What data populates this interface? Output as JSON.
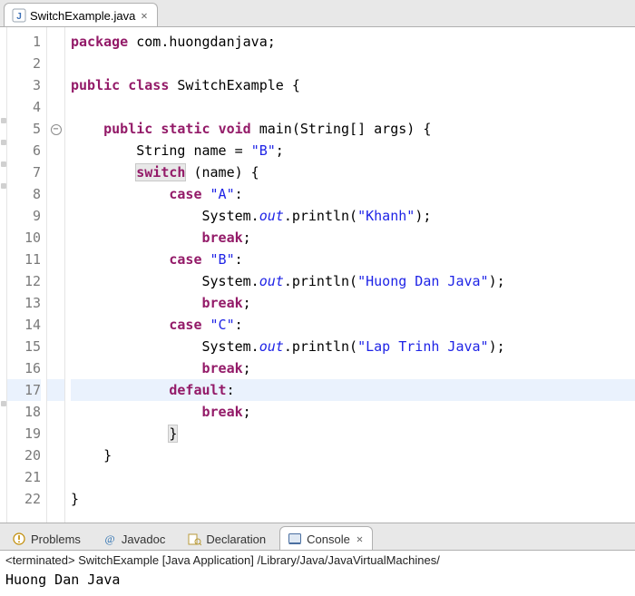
{
  "editor": {
    "tab": {
      "filename": "SwitchExample.java",
      "close_glyph": "✕"
    },
    "line_count": 22,
    "fold_line": 5,
    "current_line": 17,
    "boxed_ranges": [
      {
        "line": 7,
        "token": "switch"
      },
      {
        "line": 19,
        "token": "}"
      }
    ],
    "tokens": {
      "l1": [
        {
          "t": "kw",
          "v": "package"
        },
        {
          "t": "pun",
          "v": " "
        },
        {
          "t": "id",
          "v": "com.huongdanjava;"
        }
      ],
      "l2": [
        {
          "t": "pun",
          "v": ""
        }
      ],
      "l3": [
        {
          "t": "kw",
          "v": "public"
        },
        {
          "t": "pun",
          "v": " "
        },
        {
          "t": "kw",
          "v": "class"
        },
        {
          "t": "pun",
          "v": " "
        },
        {
          "t": "id",
          "v": "SwitchExample {"
        }
      ],
      "l4": [
        {
          "t": "pun",
          "v": ""
        }
      ],
      "l5": [
        {
          "t": "pun",
          "v": "    "
        },
        {
          "t": "kw",
          "v": "public"
        },
        {
          "t": "pun",
          "v": " "
        },
        {
          "t": "kw",
          "v": "static"
        },
        {
          "t": "pun",
          "v": " "
        },
        {
          "t": "kw",
          "v": "void"
        },
        {
          "t": "pun",
          "v": " "
        },
        {
          "t": "id",
          "v": "main(String[] args) {"
        }
      ],
      "l6": [
        {
          "t": "pun",
          "v": "        String name = "
        },
        {
          "t": "str",
          "v": "\"B\""
        },
        {
          "t": "pun",
          "v": ";"
        }
      ],
      "l7": [
        {
          "t": "pun",
          "v": "        "
        },
        {
          "t": "kw hl-box",
          "v": "switch"
        },
        {
          "t": "pun",
          "v": " (name) {"
        }
      ],
      "l8": [
        {
          "t": "pun",
          "v": "            "
        },
        {
          "t": "kw",
          "v": "case"
        },
        {
          "t": "pun",
          "v": " "
        },
        {
          "t": "str",
          "v": "\"A\""
        },
        {
          "t": "pun",
          "v": ":"
        }
      ],
      "l9": [
        {
          "t": "pun",
          "v": "                System."
        },
        {
          "t": "fld",
          "v": "out"
        },
        {
          "t": "pun",
          "v": ".println("
        },
        {
          "t": "str",
          "v": "\"Khanh\""
        },
        {
          "t": "pun",
          "v": ");"
        }
      ],
      "l10": [
        {
          "t": "pun",
          "v": "                "
        },
        {
          "t": "kw",
          "v": "break"
        },
        {
          "t": "pun",
          "v": ";"
        }
      ],
      "l11": [
        {
          "t": "pun",
          "v": "            "
        },
        {
          "t": "kw",
          "v": "case"
        },
        {
          "t": "pun",
          "v": " "
        },
        {
          "t": "str",
          "v": "\"B\""
        },
        {
          "t": "pun",
          "v": ":"
        }
      ],
      "l12": [
        {
          "t": "pun",
          "v": "                System."
        },
        {
          "t": "fld",
          "v": "out"
        },
        {
          "t": "pun",
          "v": ".println("
        },
        {
          "t": "str",
          "v": "\"Huong Dan Java\""
        },
        {
          "t": "pun",
          "v": ");"
        }
      ],
      "l13": [
        {
          "t": "pun",
          "v": "                "
        },
        {
          "t": "kw",
          "v": "break"
        },
        {
          "t": "pun",
          "v": ";"
        }
      ],
      "l14": [
        {
          "t": "pun",
          "v": "            "
        },
        {
          "t": "kw",
          "v": "case"
        },
        {
          "t": "pun",
          "v": " "
        },
        {
          "t": "str",
          "v": "\"C\""
        },
        {
          "t": "pun",
          "v": ":"
        }
      ],
      "l15": [
        {
          "t": "pun",
          "v": "                System."
        },
        {
          "t": "fld",
          "v": "out"
        },
        {
          "t": "pun",
          "v": ".println("
        },
        {
          "t": "str",
          "v": "\"Lap Trinh Java\""
        },
        {
          "t": "pun",
          "v": ");"
        }
      ],
      "l16": [
        {
          "t": "pun",
          "v": "                "
        },
        {
          "t": "kw",
          "v": "break"
        },
        {
          "t": "pun",
          "v": ";"
        }
      ],
      "l17": [
        {
          "t": "pun",
          "v": "            "
        },
        {
          "t": "kw",
          "v": "default"
        },
        {
          "t": "pun",
          "v": ":"
        }
      ],
      "l18": [
        {
          "t": "pun",
          "v": "                "
        },
        {
          "t": "kw",
          "v": "break"
        },
        {
          "t": "pun",
          "v": ";"
        }
      ],
      "l19": [
        {
          "t": "pun",
          "v": "            "
        },
        {
          "t": "pun hl-box",
          "v": "}"
        }
      ],
      "l20": [
        {
          "t": "pun",
          "v": "    }"
        }
      ],
      "l21": [
        {
          "t": "pun",
          "v": ""
        }
      ],
      "l22": [
        {
          "t": "pun",
          "v": "}"
        }
      ]
    }
  },
  "views": {
    "tabs": [
      {
        "id": "problems",
        "label": "Problems",
        "icon": "problems-icon"
      },
      {
        "id": "javadoc",
        "label": "Javadoc",
        "icon": "javadoc-icon"
      },
      {
        "id": "declaration",
        "label": "Declaration",
        "icon": "declaration-icon"
      },
      {
        "id": "console",
        "label": "Console",
        "icon": "console-icon",
        "active": true,
        "close_glyph": "✕"
      }
    ]
  },
  "console": {
    "status": "<terminated> SwitchExample [Java Application] /Library/Java/JavaVirtualMachines/",
    "output": "Huong Dan Java"
  }
}
